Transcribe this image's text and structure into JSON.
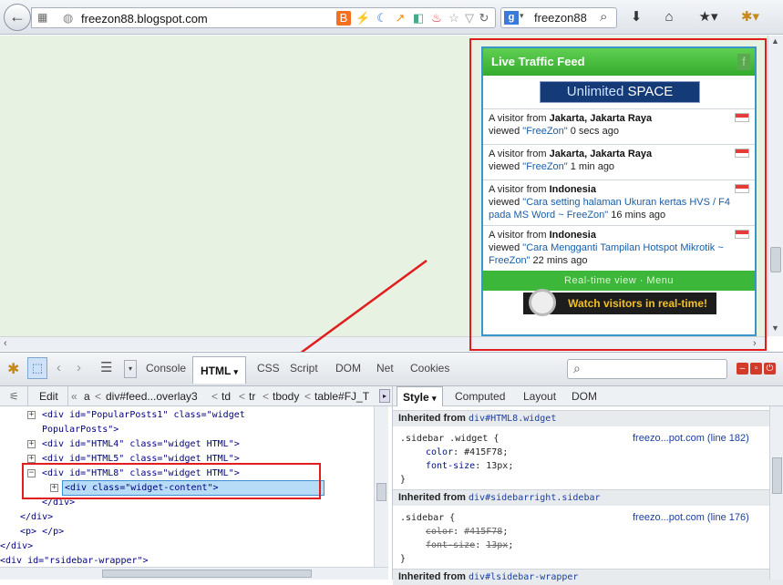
{
  "browser": {
    "url": "freezon88.blogspot.com",
    "search_value": "freezon88",
    "search_engine_icon": "google-icon"
  },
  "widget": {
    "title": "Live Traffic Feed",
    "banner_part1": "Unlimited",
    "banner_part2": "SPACE",
    "entries": [
      {
        "prefix": "A visitor from ",
        "location": "Jakarta, Jakarta Raya",
        "viewed": "viewed ",
        "page": "\"FreeZon\"",
        "time": " 0 secs ago"
      },
      {
        "prefix": "A visitor from ",
        "location": "Jakarta, Jakarta Raya",
        "viewed": "viewed ",
        "page": "\"FreeZon\"",
        "time": " 1 min ago"
      },
      {
        "prefix": "A visitor from ",
        "location": "Indonesia",
        "viewed": "viewed ",
        "page": "\"Cara setting halaman Ukuran kertas HVS / F4 pada MS Word ~ FreeZon\"",
        "time": " 16 mins ago"
      },
      {
        "prefix": "A visitor from ",
        "location": "Indonesia",
        "viewed": "viewed ",
        "page": "\"Cara Mengganti Tampilan Hotspot Mikrotik ~ FreeZon\"",
        "time": " 22 mins ago"
      }
    ],
    "realtime_bar": "Real-time view · Menu",
    "watch_part1": "Watch visitors ",
    "watch_part2": "in real-time!"
  },
  "firebug": {
    "tabs": [
      "Console",
      "HTML",
      "CSS",
      "Script",
      "DOM",
      "Net",
      "Cookies"
    ],
    "active_tab": "HTML",
    "edit_label": "Edit",
    "breadcrumb": [
      "a",
      "div#feed...overlay3",
      "td",
      "tr",
      "tbody",
      "table#FJ_T"
    ],
    "html_lines": [
      {
        "text": "<div id=\"PopularPosts1\" class=\"widget",
        "indent": 46
      },
      {
        "text": "PopularPosts\">",
        "indent": 46
      },
      {
        "text": "<div id=\"HTML4\" class=\"widget HTML\">",
        "indent": 46
      },
      {
        "text": "<div id=\"HTML5\" class=\"widget HTML\">",
        "indent": 46
      },
      {
        "text": "<div id=\"HTML8\" class=\"widget HTML\">",
        "indent": 46
      },
      {
        "text": "<div class=\"widget-content\">",
        "indent": 72
      },
      {
        "text": "</div>",
        "indent": 46
      },
      {
        "text": "</div>",
        "indent": 22
      },
      {
        "text": "<p> </p>",
        "indent": 22
      },
      {
        "text": "</div>",
        "indent": 0
      },
      {
        "text": "<div id=\"rsidebar-wrapper\">",
        "indent": 0
      }
    ],
    "side_tabs": [
      "Style",
      "Computed",
      "Layout",
      "DOM"
    ],
    "active_side_tab": "Style",
    "styles": [
      {
        "inherited_label": "Inherited from ",
        "inherited_from": "div#HTML8.widget",
        "selector": ".sidebar .widget {",
        "source": "freezo...pot.com (line 182)",
        "props": [
          {
            "name": "color",
            "value": "#415F78",
            "struck": false
          },
          {
            "name": "font-size",
            "value": "13px",
            "struck": false
          }
        ]
      },
      {
        "inherited_label": "Inherited from ",
        "inherited_from": "div#sidebarright.sidebar",
        "selector": ".sidebar {",
        "source": "freezo...pot.com (line 176)",
        "props": [
          {
            "name": "color",
            "value": "#415F78",
            "struck": true
          },
          {
            "name": "font-size",
            "value": "13px",
            "struck": true
          }
        ]
      },
      {
        "inherited_label": "Inherited from ",
        "inherited_from": "div#lsidebar-wrapper",
        "selector": "",
        "source": "",
        "props": []
      }
    ]
  },
  "colors": {
    "highlight_red": "#e11d1d",
    "feed_green": "#3cb73a",
    "banner_navy": "#143a78"
  }
}
